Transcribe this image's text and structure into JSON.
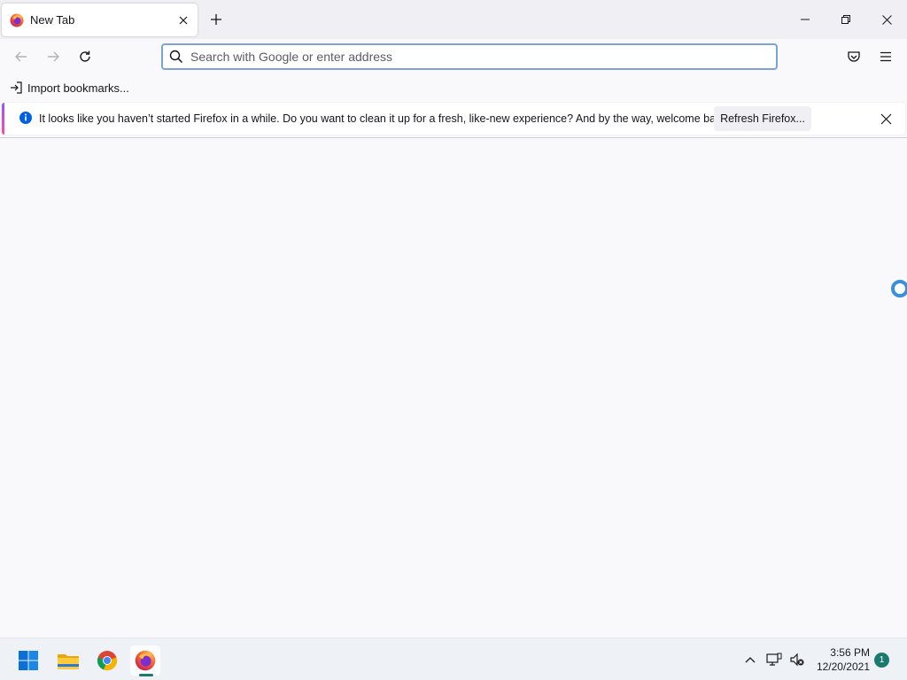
{
  "tab": {
    "title": "New Tab",
    "favicon": "firefox-icon"
  },
  "window_controls": {
    "minimize": "minimize-icon",
    "restore": "restore-icon",
    "close": "close-icon"
  },
  "navbar": {
    "back_icon": "back-arrow-icon",
    "forward_icon": "forward-arrow-icon",
    "reload_icon": "reload-icon",
    "url_value": "",
    "url_placeholder": "Search with Google or enter address",
    "pocket_icon": "pocket-icon",
    "menu_icon": "hamburger-menu-icon"
  },
  "bookmarks": {
    "import_label": "Import bookmarks..."
  },
  "notification": {
    "message": "It looks like you haven’t started Firefox in a while. Do you want to clean it up for a fresh, like-new experience? And by the way, welcome back!",
    "button_label": "Refresh Firefox...",
    "colors": {
      "accent_start": "#9059ff",
      "accent_end": "#ff4aa2",
      "info": "#0060df"
    }
  },
  "taskbar": {
    "apps": [
      "windows-start-icon",
      "file-explorer-icon",
      "chrome-icon",
      "firefox-icon"
    ],
    "tray": [
      "chevron-up-icon",
      "network-icon",
      "volume-muted-icon"
    ],
    "time": "3:56 PM",
    "date": "12/20/2021",
    "notification_count": "1"
  }
}
